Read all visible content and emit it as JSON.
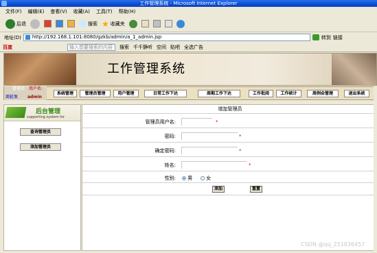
{
  "window": {
    "title": "工作管理系统 - Microsoft Internet Explorer"
  },
  "menu": [
    "文件(F)",
    "编辑(E)",
    "查看(V)",
    "收藏(A)",
    "工具(T)",
    "帮助(H)"
  ],
  "toolbar": {
    "back": "后退",
    "search": "搜索",
    "favorites": "收藏夹"
  },
  "address": {
    "label": "地址(D)",
    "url": "http://192.168.1.101:8080/gzkb/admin/a_1_admin.jsp",
    "go": "转到",
    "links": "链接"
  },
  "linksbar": {
    "logo": "百度",
    "search_placeholder": "输入想要搜索的内容",
    "items": [
      "搜索",
      "千千静听",
      "空间",
      "贴吧",
      "全选广告"
    ]
  },
  "banner": {
    "title": "工作管理系统"
  },
  "user": {
    "role": "管理员:",
    "role_label": "用户名:",
    "name_label": "周延发",
    "name": "admin"
  },
  "nav": [
    "系统管理",
    "管理员管理",
    "用户管理",
    "日常工作下达",
    "周期工作下达",
    "工作批阅",
    "工作统计",
    "周例会管理",
    "退出系统"
  ],
  "sidebar": {
    "title": "后台管理",
    "subtitle": "supporting system for",
    "buttons": [
      "查询管理员",
      "添加管理员"
    ]
  },
  "form": {
    "title": "增加管理员",
    "username_label": "管理员用户名:",
    "password_label": "密码:",
    "confirm_label": "确定密码:",
    "name_label": "姓名:",
    "gender_label": "性别:",
    "gender_options": [
      "男",
      "女"
    ],
    "gender_selected": "男",
    "required": "*",
    "submit": "添加",
    "reset": "重置"
  },
  "watermark": "CSDN @qq_251836457"
}
